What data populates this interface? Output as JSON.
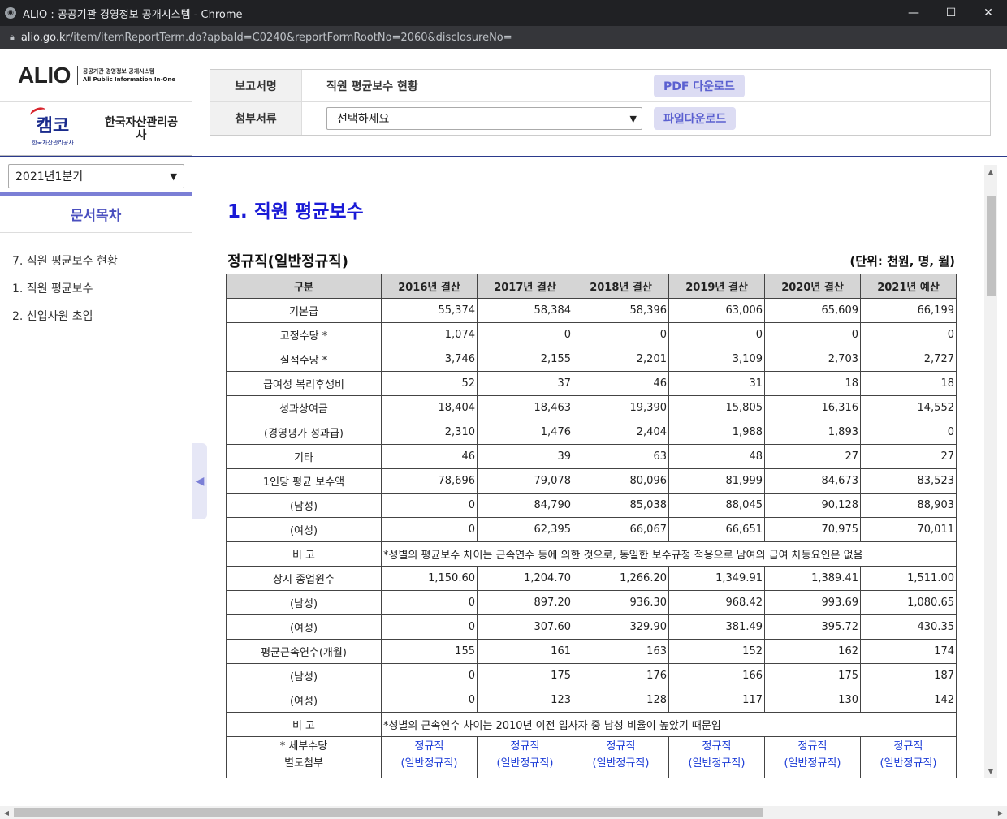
{
  "window": {
    "title": "ALIO : 공공기관 경영정보 공개시스템 - Chrome",
    "controls": [
      "—",
      "☐",
      "✕"
    ]
  },
  "address": {
    "domain": "alio.go.kr",
    "path": "/item/itemReportTerm.do?apbaId=C0240&reportFormRootNo=2060&disclosureNo="
  },
  "sidebar": {
    "logo": "ALIO",
    "logo_sub1": "공공기관 경영정보 공개시스템",
    "logo_sub2": "All Public Information In-One",
    "org_logo_mark": "캠코",
    "org_logo_text": "한국자산관리공사",
    "org_name": "한국자산관리공사",
    "period": "2021년1분기",
    "toc_title": "문서목차",
    "toc_items": [
      "7. 직원 평균보수 현황",
      "1. 직원 평균보수",
      "2. 신입사원 초임"
    ]
  },
  "header": {
    "report_label": "보고서명",
    "report_name": "직원 평균보수 현황",
    "pdf_button": "PDF 다운로드",
    "attach_label": "첨부서류",
    "attach_select": "선택하세요",
    "file_button": "파일다운로드"
  },
  "content": {
    "section_title": "1. 직원 평균보수",
    "subtitle": "정규직(일반정규직)",
    "unit": "(단위: 천원, 명, 월)",
    "columns": [
      "구분",
      "2016년 결산",
      "2017년 결산",
      "2018년 결산",
      "2019년 결산",
      "2020년 결산",
      "2021년 예산"
    ],
    "rows": [
      {
        "label": "기본급",
        "values": [
          "55,374",
          "58,384",
          "58,396",
          "63,006",
          "65,609",
          "66,199"
        ]
      },
      {
        "label": "고정수당 *",
        "values": [
          "1,074",
          "0",
          "0",
          "0",
          "0",
          "0"
        ]
      },
      {
        "label": "실적수당 *",
        "values": [
          "3,746",
          "2,155",
          "2,201",
          "3,109",
          "2,703",
          "2,727"
        ]
      },
      {
        "label": "급여성 복리후생비",
        "values": [
          "52",
          "37",
          "46",
          "31",
          "18",
          "18"
        ]
      },
      {
        "label": "성과상여금",
        "values": [
          "18,404",
          "18,463",
          "19,390",
          "15,805",
          "16,316",
          "14,552"
        ]
      },
      {
        "label": "(경영평가 성과급)",
        "values": [
          "2,310",
          "1,476",
          "2,404",
          "1,988",
          "1,893",
          "0"
        ]
      },
      {
        "label": "기타",
        "values": [
          "46",
          "39",
          "63",
          "48",
          "27",
          "27"
        ]
      },
      {
        "label": "1인당 평균 보수액",
        "values": [
          "78,696",
          "79,078",
          "80,096",
          "81,999",
          "84,673",
          "83,523"
        ]
      },
      {
        "label": "(남성)",
        "values": [
          "0",
          "84,790",
          "85,038",
          "88,045",
          "90,128",
          "88,903"
        ]
      },
      {
        "label": "(여성)",
        "values": [
          "0",
          "62,395",
          "66,067",
          "66,651",
          "70,975",
          "70,011"
        ]
      }
    ],
    "note1_label": "비 고",
    "note1": "*성별의 평균보수 차이는 근속연수 등에 의한 것으로, 동일한 보수규정 적용으로 남여의 급여 차등요인은 없음",
    "rows2": [
      {
        "label": "상시 종업원수",
        "values": [
          "1,150.60",
          "1,204.70",
          "1,266.20",
          "1,349.91",
          "1,389.41",
          "1,511.00"
        ]
      },
      {
        "label": "(남성)",
        "values": [
          "0",
          "897.20",
          "936.30",
          "968.42",
          "993.69",
          "1,080.65"
        ]
      },
      {
        "label": "(여성)",
        "values": [
          "0",
          "307.60",
          "329.90",
          "381.49",
          "395.72",
          "430.35"
        ]
      },
      {
        "label": "평균근속연수(개월)",
        "values": [
          "155",
          "161",
          "163",
          "152",
          "162",
          "174"
        ]
      },
      {
        "label": "(남성)",
        "values": [
          "0",
          "175",
          "176",
          "166",
          "175",
          "187"
        ]
      },
      {
        "label": "(여성)",
        "values": [
          "0",
          "123",
          "128",
          "117",
          "130",
          "142"
        ]
      }
    ],
    "note2_label": "비 고",
    "note2": "*성별의 근속연수 차이는 2010년 이전 입사자 중 남성 비율이 높았기 때문임",
    "attach_label_line1": "* 세부수당",
    "attach_label_line2": "별도첨부",
    "attach_link_line1": "정규직",
    "attach_link_line2": "(일반정규직)"
  }
}
